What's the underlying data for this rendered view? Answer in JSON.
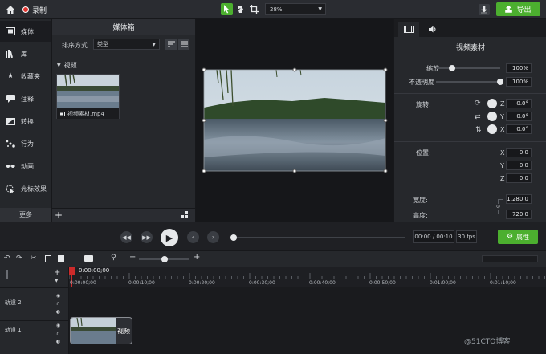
{
  "topbar": {
    "record_label": "录制",
    "zoom_value": "28%",
    "export_label": "导出"
  },
  "sidebar": {
    "items": [
      {
        "label": "媒体",
        "icon": "film-icon"
      },
      {
        "label": "库",
        "icon": "library-icon"
      },
      {
        "label": "收藏夹",
        "icon": "star-icon"
      },
      {
        "label": "注释",
        "icon": "annotation-icon"
      },
      {
        "label": "转换",
        "icon": "transition-icon"
      },
      {
        "label": "行为",
        "icon": "behavior-icon"
      },
      {
        "label": "动画",
        "icon": "animation-icon"
      },
      {
        "label": "光标效果",
        "icon": "cursor-effect-icon"
      }
    ],
    "more_label": "更多"
  },
  "media": {
    "title": "媒体箱",
    "sort_label": "排序方式",
    "sort_value": "类型",
    "group_label": "视频",
    "item_name": "视频素材.mp4"
  },
  "properties": {
    "title": "视频素材",
    "scale_label": "缩放",
    "scale_value": "100%",
    "opacity_label": "不透明度",
    "opacity_value": "100%",
    "rotation_label": "旋转:",
    "rot_z_axis": "Z",
    "rot_z": "0.0°",
    "rot_y_axis": "Y",
    "rot_y": "0.0°",
    "rot_x_axis": "X",
    "rot_x": "0.0°",
    "position_label": "位置:",
    "pos_x_axis": "X",
    "pos_x": "0.0",
    "pos_y_axis": "Y",
    "pos_y": "0.0",
    "pos_z_axis": "Z",
    "pos_z": "0.0",
    "width_label": "宽度:",
    "width_value": "1,280.0",
    "height_label": "高度:",
    "height_value": "720.0",
    "props_button": "属性"
  },
  "transport": {
    "time": "00:00 / 00:10",
    "fps": "30 fps"
  },
  "timeline": {
    "playhead_time": "0:00:00;00",
    "ticks": [
      "0:00:00;00",
      "0:00:10;00",
      "0:00:20;00",
      "0:00:30;00",
      "0:00:40;00",
      "0:00:50;00",
      "0:01:00;00",
      "0:01:10;00"
    ],
    "tracks": [
      {
        "label": "轨道 2"
      },
      {
        "label": "轨道 1"
      }
    ],
    "clip_label": "视频"
  },
  "watermark": "@51CTO博客",
  "colors": {
    "accent_green": "#4caf2f",
    "record_red": "#e0332f"
  }
}
